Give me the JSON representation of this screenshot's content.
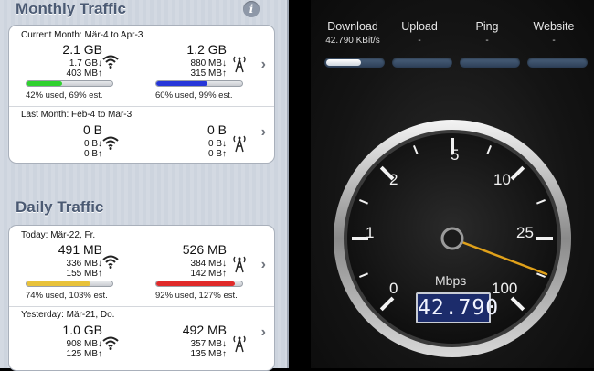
{
  "monthly": {
    "title": "Monthly Traffic",
    "info_icon": "i",
    "current": {
      "label": "Current Month: Mär-4 to Apr-3",
      "wifi": {
        "total": "2.1 GB",
        "down": "1.7 GB↓",
        "up": "403 MB↑",
        "usage_fraction": 0.42,
        "bar_color": "#2fd12f"
      },
      "cell": {
        "total": "1.2 GB",
        "down": "880 MB↓",
        "up": "315 MB↑",
        "usage_fraction": 0.6,
        "bar_color": "#2636d9"
      },
      "wifi_pct": "42% used, 69% est.",
      "cell_pct": "60% used, 99% est."
    },
    "last": {
      "label": "Last Month: Feb-4 to Mär-3",
      "wifi": {
        "total": "0 B",
        "down": "0 B↓",
        "up": "0 B↑"
      },
      "cell": {
        "total": "0 B",
        "down": "0 B↓",
        "up": "0 B↑"
      }
    }
  },
  "daily": {
    "title": "Daily Traffic",
    "today": {
      "label": "Today: Mär-22, Fr.",
      "wifi": {
        "total": "491 MB",
        "down": "336 MB↓",
        "up": "155 MB↑",
        "usage_fraction": 0.74,
        "bar_color": "#e8c23a"
      },
      "cell": {
        "total": "526 MB",
        "down": "384 MB↓",
        "up": "142 MB↑",
        "usage_fraction": 0.92,
        "bar_color": "#e02a2a"
      },
      "wifi_pct": "74% used, 103% est.",
      "cell_pct": "92% used, 127% est."
    },
    "yesterday": {
      "label": "Yesterday: Mär-21, Do.",
      "wifi": {
        "total": "1.0 GB",
        "down": "908 MB↓",
        "up": "125 MB↑"
      },
      "cell": {
        "total": "492 MB",
        "down": "357 MB↓",
        "up": "135 MB↑"
      }
    }
  },
  "speedtest": {
    "tabs": [
      {
        "label": "Download",
        "value": "42.790 KBit/s",
        "progress": 0.62
      },
      {
        "label": "Upload",
        "value": "-",
        "progress": 0
      },
      {
        "label": "Ping",
        "value": "-",
        "progress": 0
      },
      {
        "label": "Website",
        "value": "-",
        "progress": 0
      }
    ],
    "gauge": {
      "scale_labels": [
        "0",
        "1",
        "2",
        "5",
        "10",
        "25",
        "100"
      ],
      "unit": "Mbps",
      "readout": "42.790",
      "needle_value_label": "42.790"
    },
    "colors": {
      "needle": "#e0a11a",
      "readout_bg": "#1c2c6b"
    }
  }
}
